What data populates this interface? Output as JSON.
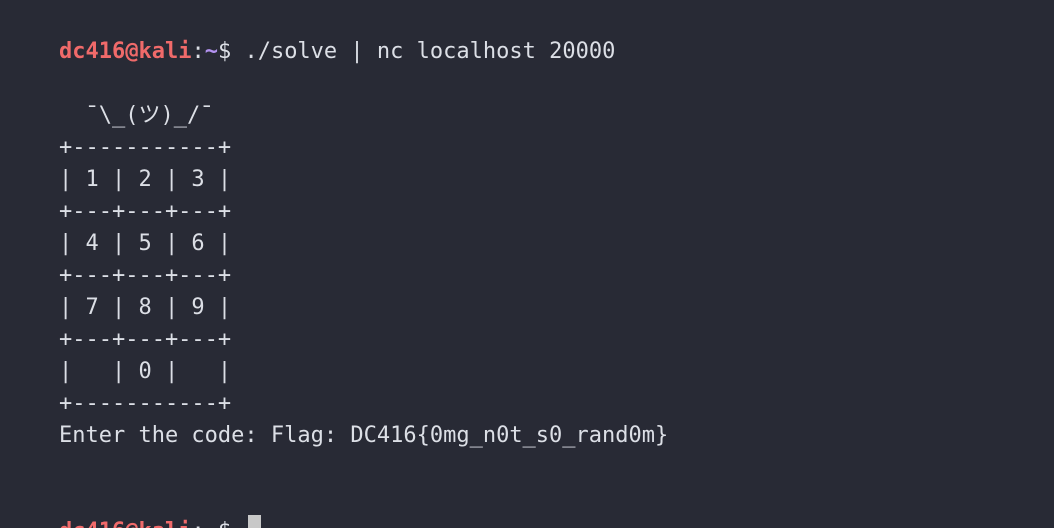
{
  "prompt": {
    "user": "dc416",
    "at": "@",
    "host": "kali",
    "colon": ":",
    "path": "~",
    "symbol": "$ "
  },
  "command": "./solve | nc localhost 20000",
  "output": [
    "      ¯\\_(ツ)_/¯",
    "    +-----------+",
    "    | 1 | 2 | 3 |",
    "    +---+---+---+",
    "    | 4 | 5 | 6 |",
    "    +---+---+---+",
    "    | 7 | 8 | 9 |",
    "    +---+---+---+",
    "    |   | 0 |   |",
    "    +-----------+",
    "    Enter the code: Flag: DC416{0mg_n0t_s0_rand0m}"
  ],
  "colors": {
    "background": "#282a35",
    "user_host": "#f06a6a",
    "path": "#b392f0",
    "text": "#dcdfe6"
  }
}
